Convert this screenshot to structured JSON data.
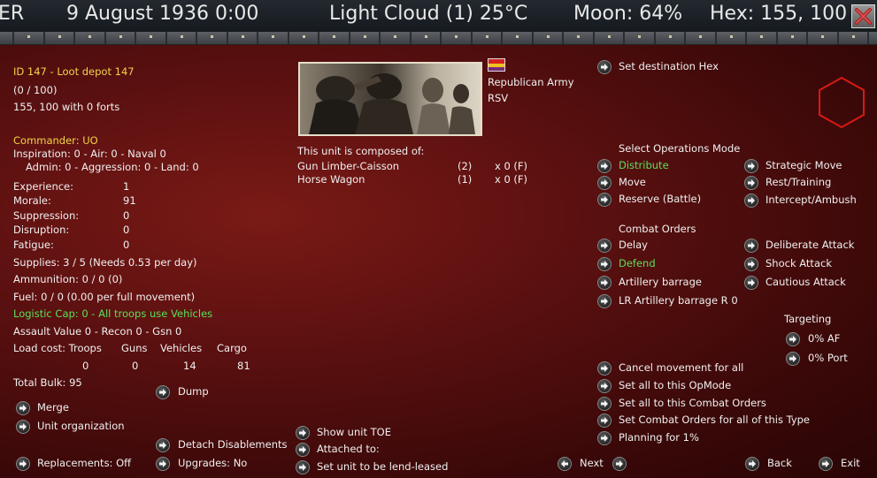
{
  "header": {
    "left_fragment": "ER",
    "date": "9 August 1936 0:00",
    "weather": "Light Cloud (1) 25°C",
    "moon": "Moon: 64%",
    "hex": "Hex: 155, 100"
  },
  "unit": {
    "id_name": "ID 147 - Loot depot 147",
    "strength": "(0 / 100)",
    "location": "155, 100 with 0 forts",
    "commander": "Commander: UO",
    "commander_stats1": "Inspiration: 0 - Air: 0 - Naval 0",
    "commander_stats2": "Admin: 0 - Aggression: 0 - Land: 0",
    "stats": [
      {
        "label": "Experience:",
        "value": "1"
      },
      {
        "label": "Morale:",
        "value": "91"
      },
      {
        "label": "Suppression:",
        "value": "0"
      },
      {
        "label": "Disruption:",
        "value": "0"
      },
      {
        "label": "Fatigue:",
        "value": "0"
      }
    ],
    "supplies": "Supplies: 3 / 5 (Needs 0.53 per day)",
    "ammunition": "Ammunition: 0 / 0 (0)",
    "fuel": "Fuel: 0 / 0 (0.00 per full movement)",
    "logistic_cap": "Logistic Cap: 0 - All troops use Vehicles",
    "assault": "Assault Value 0 - Recon 0 - Gsn 0",
    "load_cost": {
      "label": "Load cost: Troops",
      "guns_label": "Guns",
      "vehicles_label": "Vehicles",
      "cargo_label": "Cargo",
      "troops": "0",
      "guns": "0",
      "vehicles": "14",
      "cargo": "81"
    },
    "total_bulk": "Total Bulk: 95"
  },
  "army": {
    "name": "Republican Army",
    "abbr": "RSV"
  },
  "composition": {
    "heading": "This unit is composed of:",
    "items": [
      {
        "name": "Gun Limber-Caisson",
        "count": "(2)",
        "qty": "x 0 (F)"
      },
      {
        "name": "Horse Wagon",
        "count": "(1)",
        "qty": "x 0 (F)"
      }
    ]
  },
  "buttons_left": {
    "dump": "Dump",
    "merge": "Merge",
    "unit_organization": "Unit organization",
    "detach_disablements": "Detach Disablements",
    "replacements": "Replacements: Off",
    "upgrades": "Upgrades: No"
  },
  "buttons_mid": {
    "show_toe": "Show unit TOE",
    "attached_to": "Attached to:",
    "lend_lease": "Set unit to be lend-leased"
  },
  "orders": {
    "set_destination": "Set destination Hex",
    "ops_mode_heading": "Select Operations Mode",
    "ops_left": [
      "Distribute",
      "Move",
      "Reserve (Battle)"
    ],
    "ops_right": [
      "Strategic Move",
      "Rest/Training",
      "Intercept/Ambush"
    ],
    "combat_heading": "Combat Orders",
    "combat_left": [
      "Delay",
      "Defend",
      "Artillery barrage",
      "LR Artillery barrage R 0"
    ],
    "combat_right": [
      "Deliberate Attack",
      "Shock Attack",
      "Cautious Attack"
    ],
    "targeting_heading": "Targeting",
    "targeting": [
      "0% AF",
      "0% Port"
    ],
    "bulk_actions": [
      "Cancel movement for all",
      "Set all to this OpMode",
      "Set all to this Combat Orders",
      "Set Combat Orders for all of this Type",
      "Planning for 1%"
    ]
  },
  "nav": {
    "next": "Next",
    "back": "Back",
    "exit": "Exit"
  },
  "colors": {
    "highlight_yellow": "#f3d34a",
    "selected_green": "#58e05a",
    "hex_red": "#d81a14",
    "panel_red": "#5a1010"
  }
}
